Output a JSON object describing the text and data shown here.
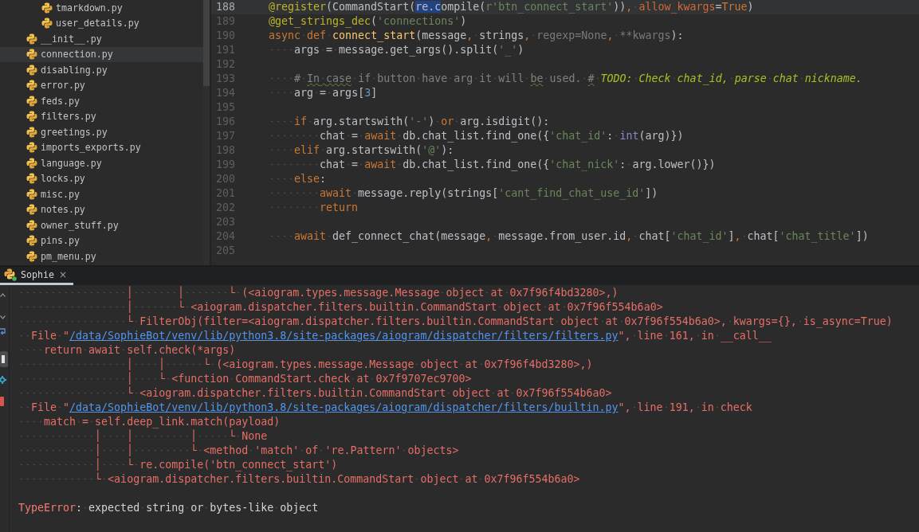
{
  "project_tree": {
    "items": [
      {
        "children": [
          {
            "label": "tmarkdown.py",
            "selected": false
          },
          {
            "label": "user_details.py",
            "selected": false
          }
        ]
      },
      {
        "label": "__init__.py",
        "selected": false
      },
      {
        "label": "connection.py",
        "selected": true
      },
      {
        "label": "disabling.py",
        "selected": false
      },
      {
        "label": "error.py",
        "selected": false
      },
      {
        "label": "feds.py",
        "selected": false
      },
      {
        "label": "filters.py",
        "selected": false
      },
      {
        "label": "greetings.py",
        "selected": false
      },
      {
        "label": "imports_exports.py",
        "selected": false
      },
      {
        "label": "language.py",
        "selected": false
      },
      {
        "label": "locks.py",
        "selected": false
      },
      {
        "label": "misc.py",
        "selected": false
      },
      {
        "label": "notes.py",
        "selected": false
      },
      {
        "label": "owner_stuff.py",
        "selected": false
      },
      {
        "label": "pins.py",
        "selected": false
      },
      {
        "label": "pm_menu.py",
        "selected": false
      }
    ]
  },
  "editor": {
    "lines": [
      {
        "number": "188",
        "current": true,
        "tokens": [
          {
            "kind": "decorator",
            "text": "@register"
          },
          {
            "kind": "plain",
            "text": "(CommandStart("
          },
          {
            "kind": "selection",
            "text": "re.c"
          },
          {
            "kind": "plain",
            "text": "ompile("
          },
          {
            "kind": "string",
            "text": "r'btn_connect_start'"
          },
          {
            "kind": "plain",
            "text": "))"
          },
          {
            "kind": "separator",
            "text": ","
          },
          {
            "kind": "param",
            "text": " allow_kwargs"
          },
          {
            "kind": "plain",
            "text": "="
          },
          {
            "kind": "keyword",
            "text": "True"
          },
          {
            "kind": "plain",
            "text": ")"
          }
        ]
      },
      {
        "number": "189",
        "current": false,
        "tokens": [
          {
            "kind": "decorator",
            "text": "@get_strings_dec"
          },
          {
            "kind": "plain",
            "text": "("
          },
          {
            "kind": "string",
            "text": "'connections'"
          },
          {
            "kind": "plain",
            "text": ")"
          }
        ]
      },
      {
        "number": "190",
        "current": false,
        "tokens": [
          {
            "kind": "keyword",
            "text": "async def"
          },
          {
            "kind": "function",
            "text": " connect_start"
          },
          {
            "kind": "plain",
            "text": "(message"
          },
          {
            "kind": "separator",
            "text": ","
          },
          {
            "kind": "plain",
            "text": " strings"
          },
          {
            "kind": "separator",
            "text": ","
          },
          {
            "kind": "unused",
            "text": " regexp=None"
          },
          {
            "kind": "separator",
            "text": ","
          },
          {
            "kind": "unused",
            "text": " **kwargs"
          },
          {
            "kind": "plain",
            "text": "):"
          }
        ]
      },
      {
        "number": "191",
        "current": false,
        "tokens": [
          {
            "kind": "plain",
            "text": "    args = message.get_args().split("
          },
          {
            "kind": "string",
            "text": "'_'"
          },
          {
            "kind": "plain",
            "text": ")"
          }
        ]
      },
      {
        "number": "192",
        "current": false
      },
      {
        "number": "193",
        "current": false,
        "tokens": [
          {
            "kind": "comment",
            "text": "    # "
          },
          {
            "kind": "typo",
            "text": "In case"
          },
          {
            "kind": "comment",
            "text": " if button have arg it will "
          },
          {
            "kind": "typo",
            "text": "be"
          },
          {
            "kind": "comment",
            "text": " used. "
          },
          {
            "kind": "typo",
            "text": "#"
          },
          {
            "kind": "todo",
            "text": " TODO: Check chat_id, parse chat nickname."
          }
        ]
      },
      {
        "number": "194",
        "current": false,
        "tokens": [
          {
            "kind": "plain",
            "text": "    arg = args["
          },
          {
            "kind": "number",
            "text": "3"
          },
          {
            "kind": "plain",
            "text": "]"
          }
        ]
      },
      {
        "number": "195",
        "current": false
      },
      {
        "number": "196",
        "current": false,
        "tokens": [
          {
            "kind": "keyword",
            "text": "    if"
          },
          {
            "kind": "plain",
            "text": " arg.startswith("
          },
          {
            "kind": "string",
            "text": "'-'"
          },
          {
            "kind": "plain",
            "text": ") "
          },
          {
            "kind": "keyword",
            "text": "or"
          },
          {
            "kind": "plain",
            "text": " arg.isdigit():"
          }
        ]
      },
      {
        "number": "197",
        "current": false,
        "tokens": [
          {
            "kind": "plain",
            "text": "        chat = "
          },
          {
            "kind": "keyword",
            "text": "await"
          },
          {
            "kind": "plain",
            "text": " db.chat_list.find_one({"
          },
          {
            "kind": "string",
            "text": "'chat_id'"
          },
          {
            "kind": "plain",
            "text": ": "
          },
          {
            "kind": "builtin",
            "text": "int"
          },
          {
            "kind": "plain",
            "text": "(arg)})"
          }
        ]
      },
      {
        "number": "198",
        "current": false,
        "tokens": [
          {
            "kind": "keyword",
            "text": "    elif"
          },
          {
            "kind": "plain",
            "text": " arg.startswith("
          },
          {
            "kind": "string",
            "text": "'@'"
          },
          {
            "kind": "plain",
            "text": "):"
          }
        ]
      },
      {
        "number": "199",
        "current": false,
        "tokens": [
          {
            "kind": "plain",
            "text": "        chat = "
          },
          {
            "kind": "keyword",
            "text": "await"
          },
          {
            "kind": "plain",
            "text": " db.chat_list.find_one({"
          },
          {
            "kind": "string",
            "text": "'chat_nick'"
          },
          {
            "kind": "plain",
            "text": ": arg.lower()})"
          }
        ]
      },
      {
        "number": "200",
        "current": false,
        "tokens": [
          {
            "kind": "keyword",
            "text": "    else"
          },
          {
            "kind": "plain",
            "text": ":"
          }
        ]
      },
      {
        "number": "201",
        "current": false,
        "tokens": [
          {
            "kind": "keyword",
            "text": "        await"
          },
          {
            "kind": "plain",
            "text": " message.reply(strings["
          },
          {
            "kind": "string",
            "text": "'cant_find_chat_use_id'"
          },
          {
            "kind": "plain",
            "text": "])"
          }
        ]
      },
      {
        "number": "202",
        "current": false,
        "tokens": [
          {
            "kind": "keyword",
            "text": "        return"
          }
        ]
      },
      {
        "number": "203",
        "current": false
      },
      {
        "number": "204",
        "current": false,
        "tokens": [
          {
            "kind": "keyword",
            "text": "    await"
          },
          {
            "kind": "plain",
            "text": " def_connect_chat(message"
          },
          {
            "kind": "separator",
            "text": ","
          },
          {
            "kind": "plain",
            "text": " message.from_user.id"
          },
          {
            "kind": "separator",
            "text": ","
          },
          {
            "kind": "plain",
            "text": " chat["
          },
          {
            "kind": "string",
            "text": "'chat_id'"
          },
          {
            "kind": "plain",
            "text": "]"
          },
          {
            "kind": "separator",
            "text": ","
          },
          {
            "kind": "plain",
            "text": " chat["
          },
          {
            "kind": "string",
            "text": "'chat_title'"
          },
          {
            "kind": "plain",
            "text": "])"
          }
        ]
      },
      {
        "number": "205",
        "current": false
      }
    ]
  },
  "run_panel": {
    "tabs": [
      {
        "label": "Sophie",
        "close": "×",
        "selected": true
      }
    ],
    "output": [
      {
        "kind": "trace",
        "text": "                 │       │       └ (<aiogram.types.message.Message object at 0x7f96f4bd3280>,)"
      },
      {
        "kind": "trace",
        "text": "                 │       └ <aiogram.dispatcher.filters.builtin.CommandStart object at 0x7f96f554b6a0>"
      },
      {
        "kind": "trace",
        "text": "                 └ FilterObj(filter=<aiogram.dispatcher.filters.builtin.CommandStart object at 0x7f96f554b6a0>, kwargs={}, is_async=True)"
      },
      {
        "kind": "file",
        "prefix": "  File \"",
        "path": "/data/SophieBot/venv/lib/python3.8/site-packages/aiogram/dispatcher/filters/filters.py",
        "suffix": "\", line 161, in __call__"
      },
      {
        "kind": "trace",
        "text": "    return await self.check(*args)"
      },
      {
        "kind": "trace",
        "text": "                 │    │      └ (<aiogram.types.message.Message object at 0x7f96f4bd3280>,)"
      },
      {
        "kind": "trace",
        "text": "                 │    └ <function CommandStart.check at 0x7f9707ec9700>"
      },
      {
        "kind": "trace",
        "text": "                 └ <aiogram.dispatcher.filters.builtin.CommandStart object at 0x7f96f554b6a0>"
      },
      {
        "kind": "file",
        "prefix": "  File \"",
        "path": "/data/SophieBot/venv/lib/python3.8/site-packages/aiogram/dispatcher/filters/builtin.py",
        "suffix": "\", line 191, in check"
      },
      {
        "kind": "trace",
        "text": "    match = self.deep_link.match(payload)"
      },
      {
        "kind": "trace",
        "text": "            │    │         │     └ None"
      },
      {
        "kind": "trace",
        "text": "            │    │         └ <method 'match' of 're.Pattern' objects>"
      },
      {
        "kind": "trace",
        "text": "            │    └ re.compile('btn_connect_start')"
      },
      {
        "kind": "trace",
        "text": "            └ <aiogram.dispatcher.filters.builtin.CommandStart object at 0x7f96f554b6a0>"
      },
      {
        "kind": "error",
        "error_type": "TypeError",
        "message": ": expected string or bytes-like object"
      }
    ]
  }
}
